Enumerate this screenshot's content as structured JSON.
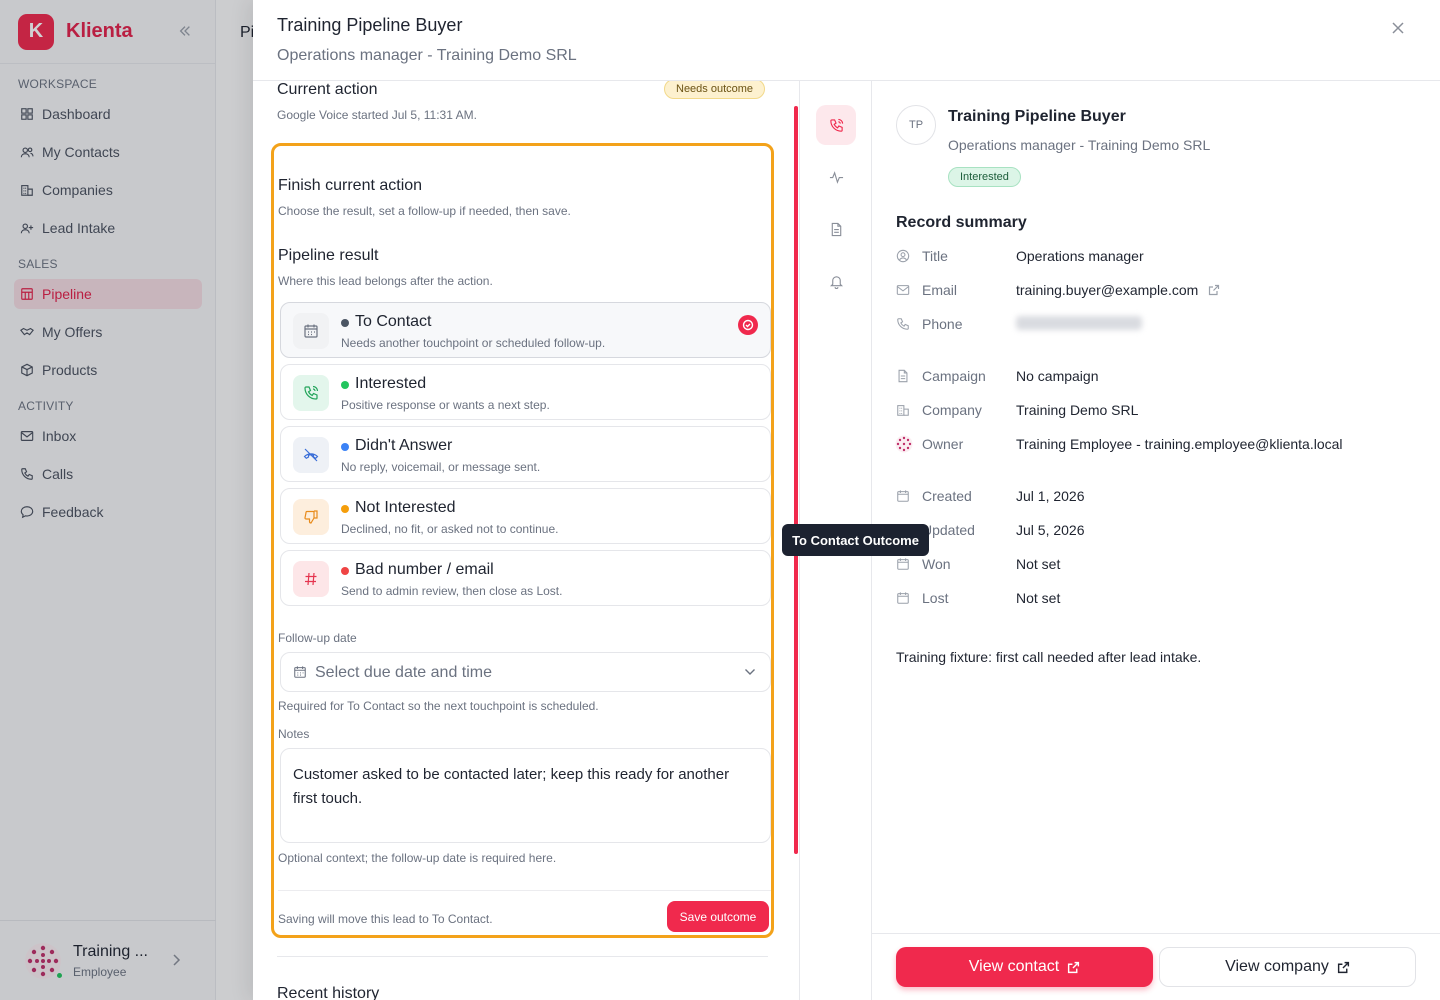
{
  "sidebar": {
    "brand": "Klienta",
    "logo_letter": "K",
    "sections": {
      "workspace": "WORKSPACE",
      "sales": "SALES",
      "activity": "ACTIVITY"
    },
    "items": [
      "Dashboard",
      "My Contacts",
      "Companies",
      "Lead Intake",
      "Pipeline",
      "My Offers",
      "Products",
      "Inbox",
      "Calls",
      "Feedback"
    ],
    "active_item": "Pipeline",
    "user": {
      "name": "Training ...",
      "role": "Employee"
    }
  },
  "background": {
    "page_title_fragment": "Pi"
  },
  "drawer": {
    "title": "Training Pipeline Buyer",
    "subtitle": "Operations manager - Training Demo SRL"
  },
  "action": {
    "heading": "Current action",
    "badge": "Needs outcome",
    "started": "Google Voice started Jul 5, 11:31 AM.",
    "finish_heading": "Finish current action",
    "finish_desc": "Choose the result, set a follow-up if needed, then save.",
    "pipeline_heading": "Pipeline result",
    "pipeline_desc": "Where this lead belongs after the action.",
    "options": [
      {
        "label": "To Contact",
        "desc": "Needs another touchpoint or scheduled follow-up.",
        "color": "#4b5563",
        "icon": "calendar-icon",
        "selected": true
      },
      {
        "label": "Interested",
        "desc": "Positive response or wants a next step.",
        "color": "#22c55e",
        "icon": "phone-call-icon"
      },
      {
        "label": "Didn't Answer",
        "desc": "No reply, voicemail, or message sent.",
        "color": "#3b82f6",
        "icon": "phone-missed-icon"
      },
      {
        "label": "Not Interested",
        "desc": "Declined, no fit, or asked not to continue.",
        "color": "#f59e0b",
        "icon": "thumbs-down-icon"
      },
      {
        "label": "Bad number / email",
        "desc": "Send to admin review, then close as Lost.",
        "color": "#ef4444",
        "icon": "hash-icon"
      }
    ],
    "followup_label": "Follow-up date",
    "followup_placeholder": "Select due date and time",
    "followup_hint": "Required for To Contact so the next touchpoint is scheduled.",
    "notes_label": "Notes",
    "notes_value": "Customer asked to be contacted later; keep this ready for another first touch.",
    "notes_hint": "Optional context; the follow-up date is required here.",
    "save_hint": "Saving will move this lead to To Contact.",
    "save_label": "Save outcome",
    "recent_history": "Recent history"
  },
  "tooltip": "To Contact Outcome",
  "record": {
    "initials": "TP",
    "name": "Training Pipeline Buyer",
    "subtitle": "Operations manager - Training Demo SRL",
    "status": "Interested",
    "summary_heading": "Record summary",
    "fields": [
      {
        "key": "Title",
        "value": "Operations manager",
        "icon": "user-circle-icon"
      },
      {
        "key": "Email",
        "value": "training.buyer@example.com",
        "icon": "mail-icon"
      },
      {
        "key": "Phone",
        "value": "",
        "icon": "phone-icon"
      },
      {
        "key": "Campaign",
        "value": "No campaign",
        "icon": "document-icon"
      },
      {
        "key": "Company",
        "value": "Training Demo SRL",
        "icon": "building-icon"
      },
      {
        "key": "Owner",
        "value": "Training Employee - training.employee@klienta.local",
        "icon": "owner-avatar-icon"
      },
      {
        "key": "Created",
        "value": "Jul 1, 2026",
        "icon": "calendar-icon"
      },
      {
        "key": "Updated",
        "value": "Jul 5, 2026",
        "icon": "calendar-icon"
      },
      {
        "key": "Won",
        "value": "Not set",
        "icon": "calendar-icon"
      },
      {
        "key": "Lost",
        "value": "Not set",
        "icon": "calendar-icon"
      }
    ],
    "fixture_note": "Training fixture: first call needed after lead intake.",
    "view_contact": "View contact",
    "view_company": "View company"
  }
}
